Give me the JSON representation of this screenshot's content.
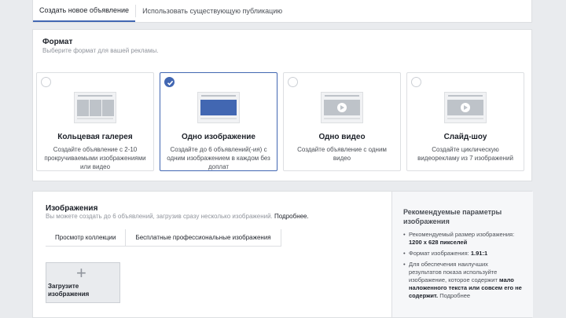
{
  "tabs": {
    "create": "Создать новое объявление",
    "existing": "Использовать существующую публикацию"
  },
  "format": {
    "title": "Формат",
    "subtitle": "Выберите формат для вашей рекламы.",
    "cards": [
      {
        "title": "Кольцевая галерея",
        "desc": "Создайте объявление с 2-10 прокручиваемыми изображениями или видео",
        "selected": false
      },
      {
        "title": "Одно изображение",
        "desc": "Создайте до 6 объявлений(-ия) с одним изображением в каждом без доплат",
        "selected": true
      },
      {
        "title": "Одно видео",
        "desc": "Создайте объявление с одним видео",
        "selected": false
      },
      {
        "title": "Слайд-шоу",
        "desc": "Создайте циклическую видеорекламу из 7 изображений",
        "selected": false
      }
    ]
  },
  "images": {
    "title": "Изображения",
    "subtitle": "Вы можете создать до 6 объявлений, загрузив сразу несколько изображений.",
    "learn_more": "Подробнее.",
    "tabs": [
      "Просмотр коллекции",
      "Бесплатные профессиональные изображения"
    ],
    "upload_label": "Загрузите изображения",
    "upload_icon": "plus-icon"
  },
  "recommendations": {
    "title": "Рекомендуемые параметры изображения",
    "item1_prefix": "Рекомендуемый размер изображения:",
    "item1_value": "1200 x 628 пикселей",
    "item2_prefix": "Формат изображения:",
    "item2_value": "1.91:1",
    "item3_prefix": "Для обеспечения наилучших результатов показа используйте изображение, которое содержит",
    "item3_bold": "мало наложенного текста или совсем его не содержит.",
    "item3_link": "Подробнее"
  },
  "colors": {
    "accent": "#4267b2",
    "background": "#e9ebee"
  }
}
